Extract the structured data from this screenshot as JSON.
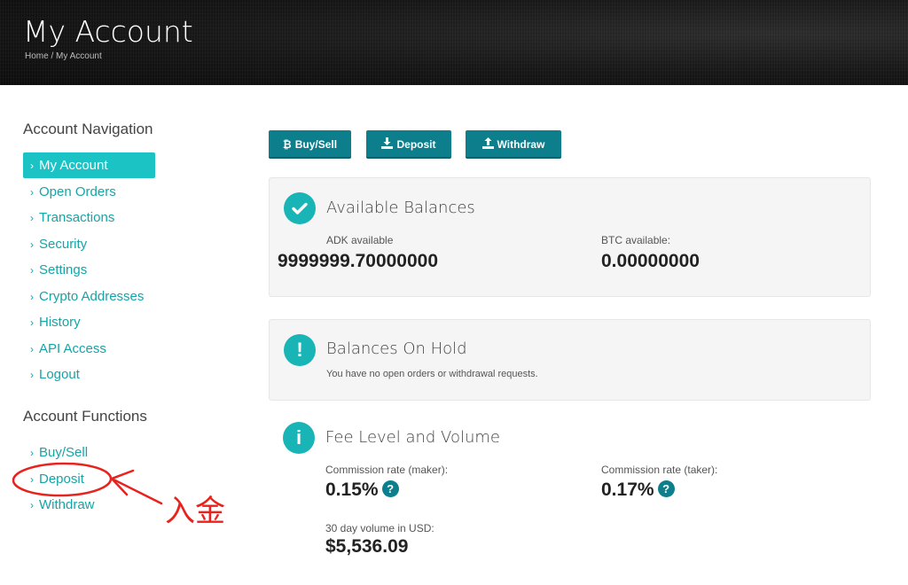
{
  "header": {
    "title": "My Account",
    "breadcrumb": {
      "home": "Home",
      "separator": "/",
      "current": "My Account"
    }
  },
  "sidebar": {
    "nav_heading": "Account Navigation",
    "nav_items": [
      {
        "label": "My Account",
        "active": true
      },
      {
        "label": "Open Orders"
      },
      {
        "label": "Transactions"
      },
      {
        "label": "Security"
      },
      {
        "label": "Settings"
      },
      {
        "label": "Crypto Addresses"
      },
      {
        "label": "History"
      },
      {
        "label": "API Access"
      },
      {
        "label": "Logout"
      }
    ],
    "functions_heading": "Account Functions",
    "function_items": [
      {
        "label": "Buy/Sell"
      },
      {
        "label": "Deposit"
      },
      {
        "label": "Withdraw"
      }
    ]
  },
  "actions": {
    "buysell": "Buy/Sell",
    "deposit": "Deposit",
    "withdraw": "Withdraw"
  },
  "balances": {
    "title": "Available Balances",
    "adk_label": "ADK available",
    "adk_value": "9999999.70000000",
    "btc_label": "BTC available:",
    "btc_value": "0.00000000"
  },
  "on_hold": {
    "title": "Balances On Hold",
    "note": "You have no open orders or withdrawal requests."
  },
  "fees": {
    "title": "Fee Level and Volume",
    "maker_label": "Commission rate (maker):",
    "maker_value": "0.15%",
    "taker_label": "Commission rate (taker):",
    "taker_value": "0.17%",
    "volume_label": "30 day volume in USD:",
    "volume_value": "$5,536.09"
  },
  "annotation": {
    "text": "入金",
    "color": "#e8231e"
  },
  "colors": {
    "accent": "#1bc3c4",
    "link": "#15a5a6",
    "button": "#0d7f8c"
  }
}
